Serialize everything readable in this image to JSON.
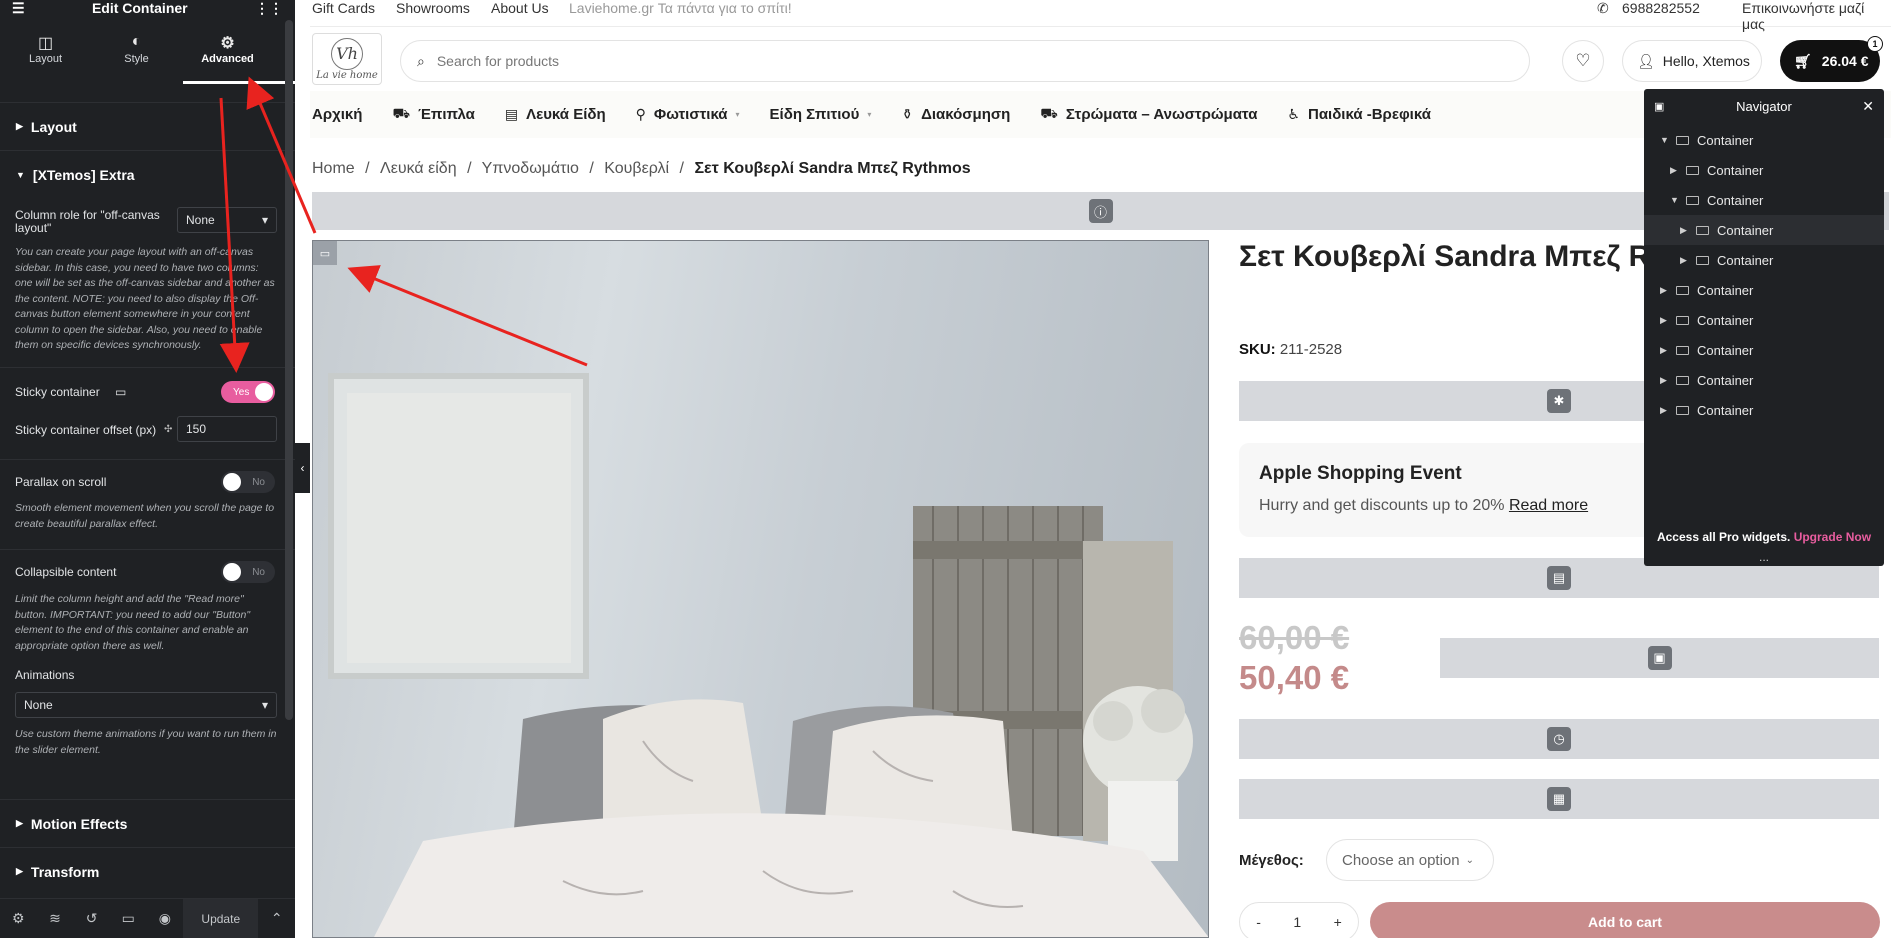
{
  "editor": {
    "title": "Edit Container",
    "tabs": [
      {
        "label": "Layout",
        "icon": "layout-icon"
      },
      {
        "label": "Style",
        "icon": "style-icon"
      },
      {
        "label": "Advanced",
        "icon": "gear-icon"
      }
    ],
    "sections": {
      "layout": "Layout",
      "extra": "[XTemos] Extra",
      "motion": "Motion Effects",
      "transform": "Transform"
    },
    "column_role": {
      "label": "Column role for \"off-canvas layout\"",
      "value": "None",
      "help": "You can create your page layout with an off-canvas sidebar. In this case, you need to have two columns: one will be set as the off-canvas sidebar and another as the content. NOTE: you need to also display the Off-canvas button element somewhere in your content column to open the sidebar. Also, you need to enable them on specific devices synchronously."
    },
    "sticky": {
      "label": "Sticky container",
      "value": "Yes"
    },
    "sticky_offset": {
      "label": "Sticky container offset (px)",
      "value": "150"
    },
    "parallax": {
      "label": "Parallax on scroll",
      "value": "No",
      "help": "Smooth element movement when you scroll the page to create beautiful parallax effect."
    },
    "collapsible": {
      "label": "Collapsible content",
      "value": "No",
      "help": "Limit the column height and add the \"Read more\" button. IMPORTANT: you need to add our \"Button\" element to the end of this container and enable an appropriate option there as well."
    },
    "animations": {
      "label": "Animations",
      "value": "None",
      "help": "Use custom theme animations if you want to run them in the slider element."
    },
    "footer": {
      "update": "Update"
    }
  },
  "site": {
    "topbar": {
      "links": [
        "Gift Cards",
        "Showrooms",
        "About Us"
      ],
      "tagline": "Laviehome.gr Τα πάντα για το σπίτι!",
      "phone": "6988282552",
      "contact": "Επικοινωνήστε μαζί μας"
    },
    "logo": {
      "mark": "Vh",
      "text": "La vie home"
    },
    "search": {
      "placeholder": "Search for products"
    },
    "account": "Hello, Xtemos",
    "cart": {
      "total": "26.04 €",
      "count": "1"
    },
    "nav": [
      {
        "label": "Αρχική",
        "icon": ""
      },
      {
        "label": "Έπιπλα",
        "icon": "sofa-icon"
      },
      {
        "label": "Λευκά Είδη",
        "icon": "linen-icon"
      },
      {
        "label": "Φωτιστικά",
        "icon": "lamp-icon",
        "dropdown": true
      },
      {
        "label": "Είδη Σπιτιού",
        "icon": "",
        "dropdown": true
      },
      {
        "label": "Διακόσμηση",
        "icon": "vase-icon"
      },
      {
        "label": "Στρώματα – Ανωστρώματα",
        "icon": "bed-icon"
      },
      {
        "label": "Παιδικά -Βρεφικά",
        "icon": "stroller-icon"
      }
    ],
    "breadcrumb": [
      "Home",
      "Λευκά είδη",
      "Υπνοδωμάτιο",
      "Κουβερλί"
    ],
    "breadcrumb_current": "Σετ Κουβερλί Sandra Μπεζ Rythmos",
    "product": {
      "title": "Σετ Κουβερλί Sandra Μπεζ Ryth",
      "sku_label": "SKU:",
      "sku": "211-2528",
      "promo_title": "Apple Shopping Event",
      "promo_text": "Hurry and get discounts up to 20%",
      "promo_link": "Read more",
      "old_price": "60,00 €",
      "new_price": "50,40 €",
      "size_label": "Μέγεθος:",
      "size_placeholder": "Choose an option",
      "qty": "1",
      "add_to_cart": "Add to cart"
    }
  },
  "navigator": {
    "title": "Navigator",
    "items": [
      "Container",
      "Container",
      "Container",
      "Container",
      "Container",
      "Container",
      "Container",
      "Container",
      "Container",
      "Container"
    ],
    "pro_text": "Access all Pro widgets.",
    "pro_link": "Upgrade Now",
    "more": "..."
  },
  "colors": {
    "accent": "#e85d9f",
    "panel": "#1f2124",
    "price": "#c48a8a",
    "button": "#c98c8c"
  }
}
